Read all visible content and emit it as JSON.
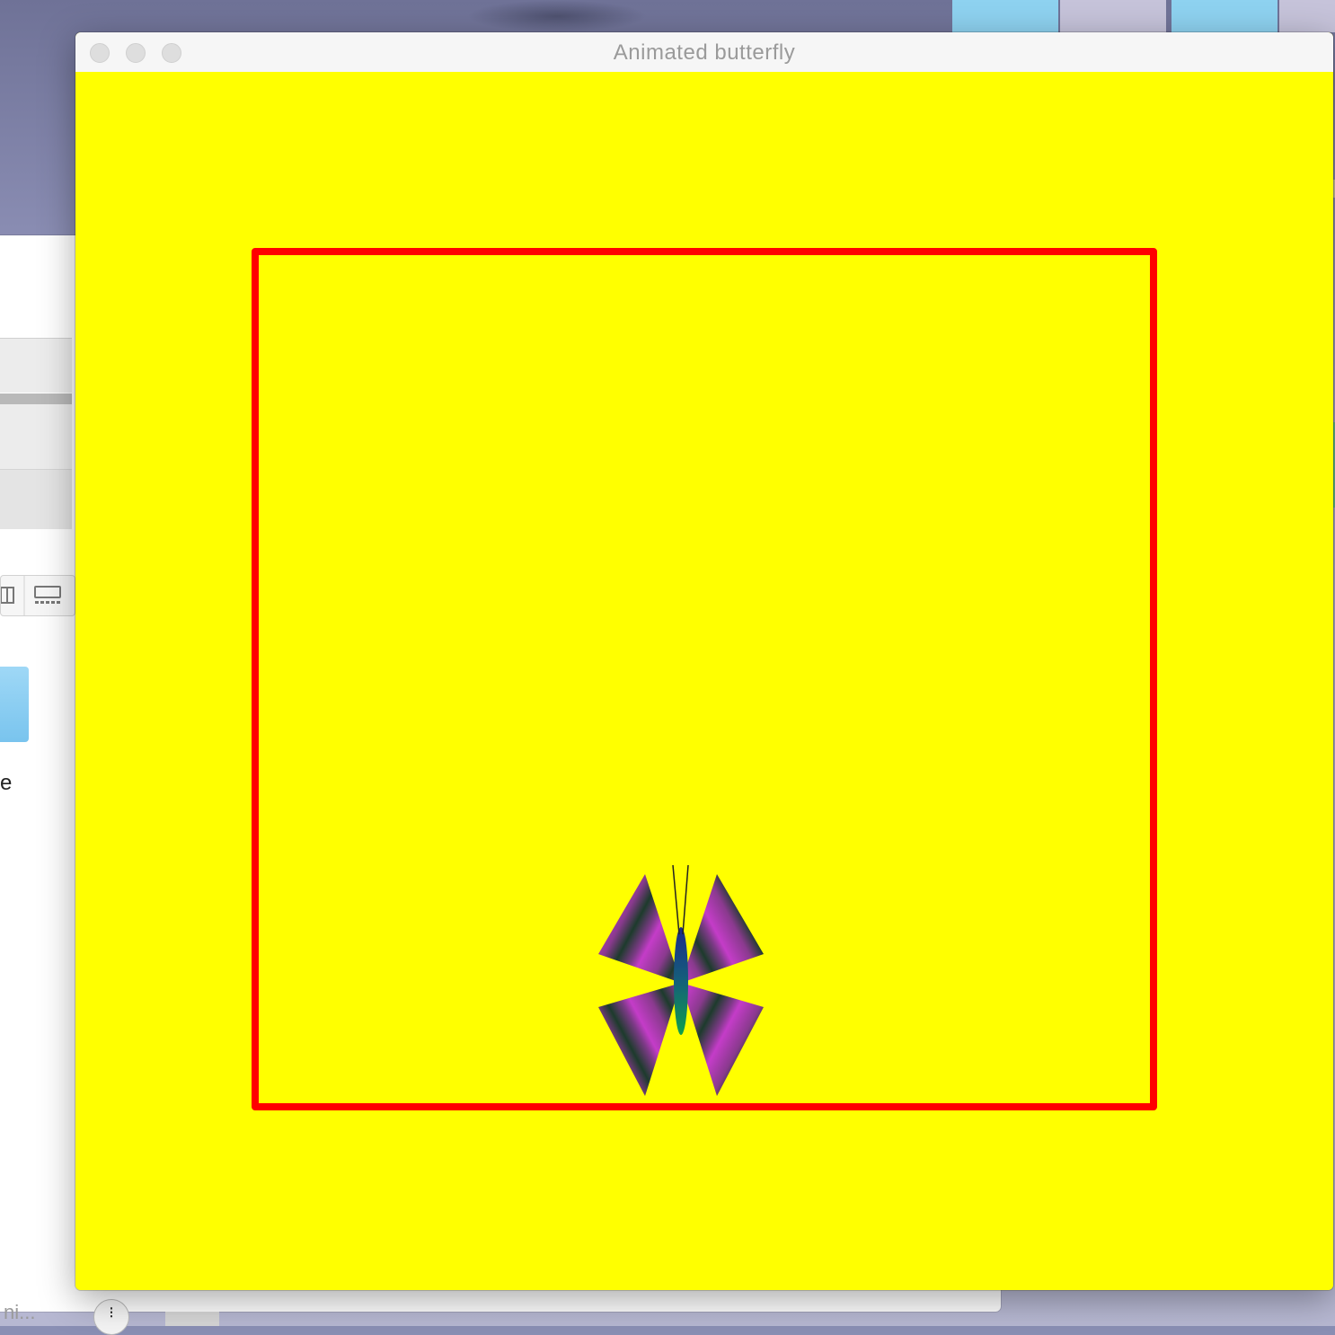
{
  "window": {
    "title": "Animated butterfly",
    "canvas_background": "#ffff00",
    "border_color": "#ff0000"
  },
  "butterfly": {
    "wing_colors": [
      "#c43cc8",
      "#1d3b2c"
    ],
    "body_colors": [
      "#1a2a8a",
      "#0fa04a"
    ]
  },
  "background_window": {
    "partial_text": "e",
    "bottom_text": "ni...",
    "bottom_button_glyph": "⁝"
  },
  "icons": [
    "close-icon",
    "minimize-icon",
    "zoom-icon",
    "sidebar-toggle-icon",
    "gallery-view-icon",
    "folder-icon"
  ]
}
